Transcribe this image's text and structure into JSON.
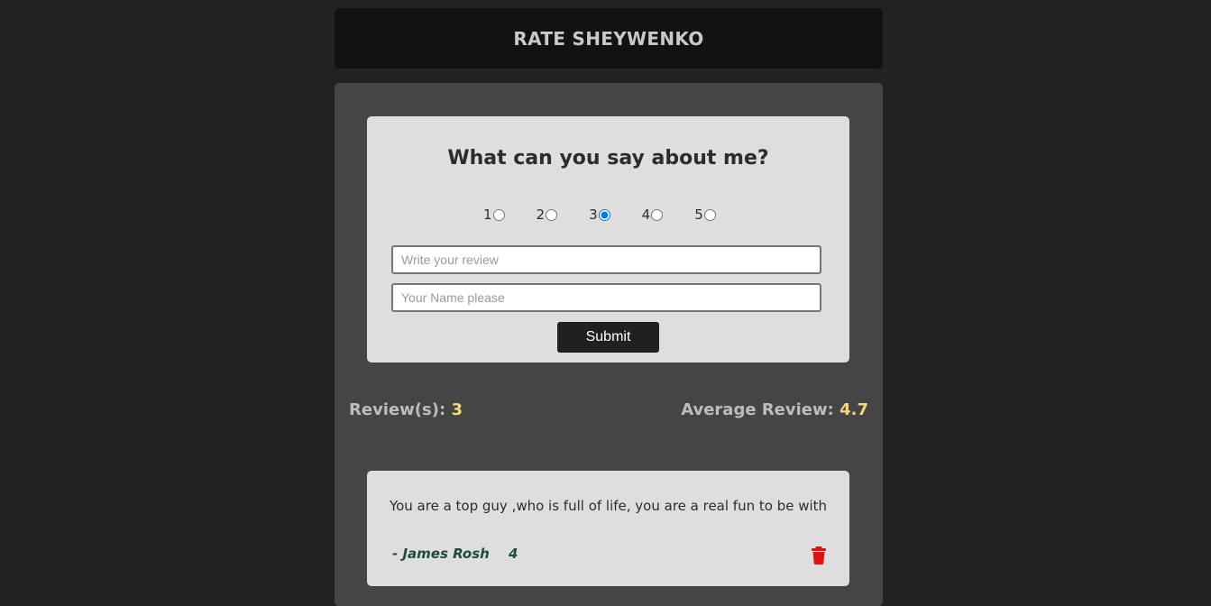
{
  "header": {
    "title": "RATE SHEYWENKO"
  },
  "form": {
    "heading": "What can you say about me?",
    "rating_options": [
      "1",
      "2",
      "3",
      "4",
      "5"
    ],
    "selected_rating": "3",
    "review_placeholder": "Write your review",
    "name_placeholder": "Your Name please",
    "submit_label": "Submit"
  },
  "stats": {
    "reviews_label": "Review(s):",
    "reviews_count": "3",
    "average_label": "Average Review:",
    "average_value": "4.7"
  },
  "reviews": [
    {
      "text": "You are a top guy ,who is full of life, you are a real fun to be with",
      "author": "- James Rosh",
      "rating": "4"
    }
  ],
  "colors": {
    "page_background": "#222222",
    "header_background": "#121212",
    "panel_background": "#454545",
    "card_background": "#dedede",
    "stat_highlight": "#f1d87e",
    "author_color": "#1f4d3c",
    "delete_icon": "#e01010",
    "button_background": "#202020"
  },
  "icons": {
    "delete": "trash-icon"
  }
}
